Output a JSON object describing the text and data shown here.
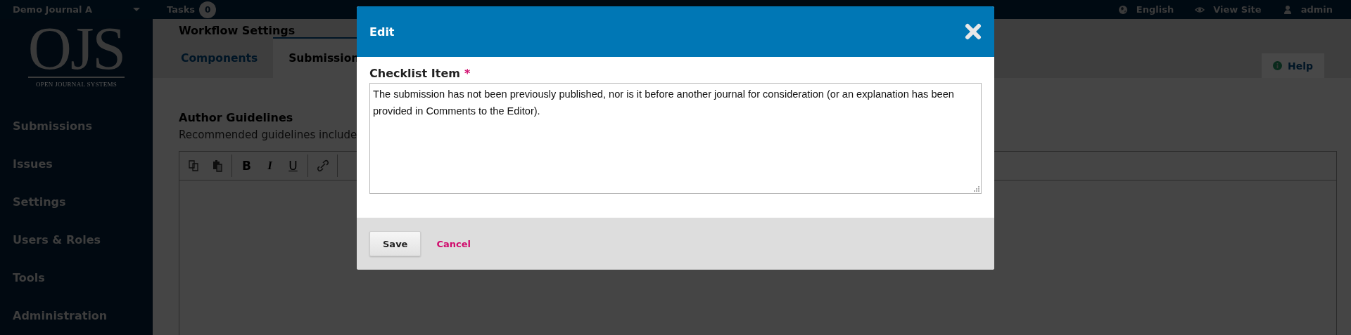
{
  "top_bar": {
    "journal": "Demo Journal A",
    "tasks_label": "Tasks",
    "tasks_count": "0",
    "links": [
      {
        "kind": "globe",
        "label": "English"
      },
      {
        "kind": "eye",
        "label": "View Site"
      },
      {
        "kind": "user",
        "label": "admin"
      }
    ]
  },
  "logo": {
    "mark": "OJS",
    "tagline": "OPEN JOURNAL SYSTEMS"
  },
  "sidebar": {
    "items": [
      {
        "label": "Submissions"
      },
      {
        "label": "Issues"
      },
      {
        "label": "Settings"
      },
      {
        "label": "Users & Roles"
      },
      {
        "label": "Tools"
      },
      {
        "label": "Administration"
      }
    ]
  },
  "page": {
    "title": "Workflow Settings",
    "tabs": [
      {
        "label": "Components",
        "selected": false
      },
      {
        "label": "Submission",
        "selected": true
      }
    ],
    "help": "Help"
  },
  "section": {
    "title": "Author Guidelines",
    "description": "Recommended guidelines include",
    "toolbar": [
      [
        {
          "kind": "copy"
        },
        {
          "kind": "paste"
        }
      ],
      [
        {
          "kind": "bold",
          "label": "B"
        },
        {
          "kind": "italic",
          "label": "I"
        },
        {
          "kind": "underline",
          "label": "U"
        }
      ],
      [
        {
          "kind": "link"
        }
      ]
    ]
  },
  "modal": {
    "title": "Edit",
    "field": {
      "label": "Checklist Item",
      "required_mark": "*",
      "value": "The submission has not been previously published, nor is it before another journal for consideration (or an explanation has been provided in Comments to the Editor)."
    },
    "buttons": [
      {
        "kind": "primary",
        "label": "Save"
      },
      {
        "kind": "link",
        "label": "Cancel"
      }
    ]
  }
}
